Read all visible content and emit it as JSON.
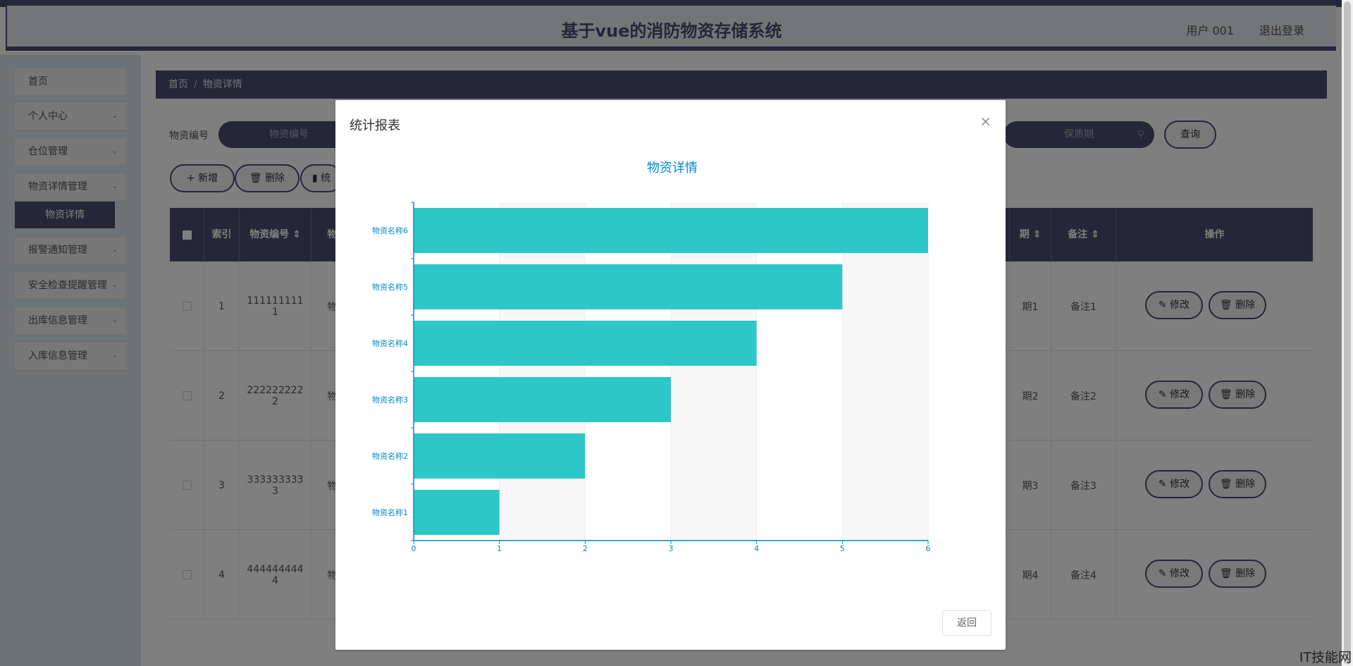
{
  "header": {
    "title": "基于vue的消防物资存储系统",
    "user": "用户 001",
    "logout": "退出登录"
  },
  "sidebar": {
    "items": [
      {
        "label": "首页",
        "chevron": false
      },
      {
        "label": "个人中心",
        "chevron": true
      },
      {
        "label": "仓位管理",
        "chevron": true
      },
      {
        "label": "物资详情管理",
        "chevron": true
      },
      {
        "label": "报警通知管理",
        "chevron": true
      },
      {
        "label": "安全检查提醒管理",
        "chevron": true
      },
      {
        "label": "出库信息管理",
        "chevron": true
      },
      {
        "label": "入库信息管理",
        "chevron": true
      }
    ],
    "active_sub": "物资详情"
  },
  "breadcrumb": {
    "home": "首页",
    "sep": "/",
    "current": "物资详情"
  },
  "search": {
    "label": "物资编号",
    "placeholder1": "物资编号",
    "placeholder2": "保质期",
    "query": "查询"
  },
  "toolbar": {
    "add": "新增",
    "delete": "删除",
    "stats": "统"
  },
  "table": {
    "headers": [
      "索引",
      "物资编号",
      "物",
      "期",
      "备注",
      "操作"
    ],
    "rows": [
      {
        "index": "1",
        "code": "111111111",
        "code2": "1",
        "name": "物",
        "period": "期1",
        "remark": "备注1"
      },
      {
        "index": "2",
        "code": "222222222",
        "code2": "2",
        "name": "物",
        "period": "期2",
        "remark": "备注2"
      },
      {
        "index": "3",
        "code": "333333333",
        "code2": "3",
        "name": "物",
        "period": "期3",
        "remark": "备注3"
      },
      {
        "index": "4",
        "code": "444444444",
        "code2": "4",
        "name": "物",
        "period": "期4",
        "remark": "备注4"
      }
    ],
    "edit": "修改",
    "delete": "删除"
  },
  "dialog": {
    "title": "统计报表",
    "close": "×",
    "back": "返回"
  },
  "chart_data": {
    "type": "bar",
    "orientation": "horizontal",
    "title": "物资详情",
    "categories": [
      "物资名称1",
      "物资名称2",
      "物资名称3",
      "物资名称4",
      "物资名称5",
      "物资名称6"
    ],
    "values": [
      1,
      2,
      3,
      4,
      5,
      6
    ],
    "xlim": [
      0,
      6
    ],
    "xticks": [
      "0",
      "1",
      "2",
      "3",
      "4",
      "5",
      "6"
    ],
    "grid": true,
    "bar_color": "#2ec7c9",
    "axis_color": "#008acd"
  },
  "watermark": "IT技能网",
  "colors": {
    "primary": "#4a4c6e",
    "chart_bar": "#2ec7c9",
    "chart_axis": "#008acd"
  }
}
